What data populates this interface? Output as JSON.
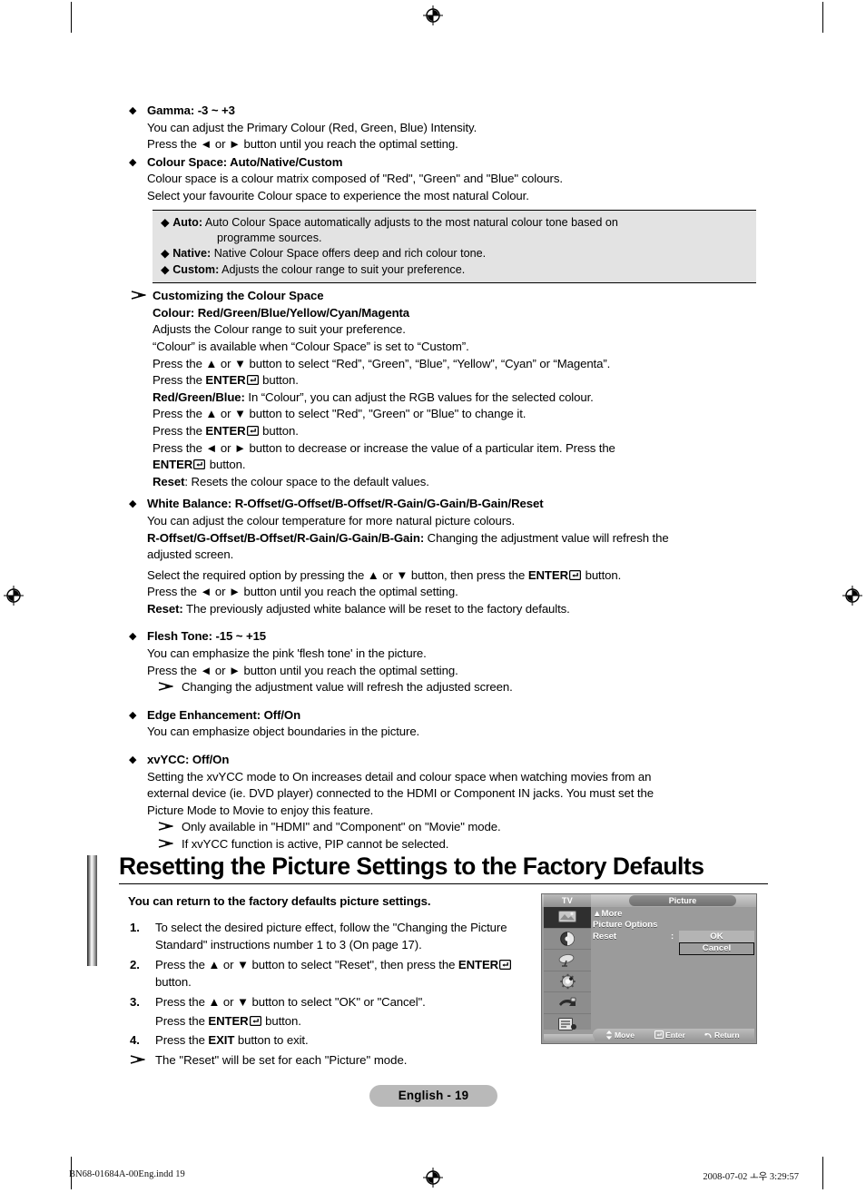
{
  "page": {
    "language_badge": "English - 19",
    "print_footer_left": "BN68-01684A-00Eng.indd   19",
    "print_footer_right": "2008-07-02   ㅗ우 3:29:57"
  },
  "sections": [
    {
      "id": "gamma",
      "heading": "Gamma: -3 ~ +3",
      "lines": [
        "You can adjust the Primary Colour (Red, Green, Blue) Intensity.",
        "Press the ◄ or ► button until you reach the optimal setting."
      ]
    },
    {
      "id": "colour-space",
      "heading": "Colour Space: Auto/Native/Custom",
      "lines": [
        "Colour space is a colour matrix composed of \"Red\", \"Green\" and \"Blue\" colours.",
        "Select your favourite Colour space to experience the most natural Colour."
      ]
    }
  ],
  "option_box": {
    "items": [
      {
        "term": "Auto:",
        "text": "Auto Colour Space automatically adjusts to the most natural colour tone based on",
        "cont": "programme sources."
      },
      {
        "term": "Native:",
        "text": "Native Colour Space offers deep and rich colour tone."
      },
      {
        "term": "Custom:",
        "text": "Adjusts the colour range to suit your preference."
      }
    ]
  },
  "customizing": {
    "note_title": "Customizing the Colour Space",
    "subheading": "Colour: Red/Green/Blue/Yellow/Cyan/Magenta",
    "lines": [
      "Adjusts the Colour range to suit your preference.",
      "“Colour” is available when “Colour Space” is set to “Custom”.",
      "Press the ▲ or ▼ button to select “Red”, “Green”, “Blue”, “Yellow”, “Cyan” or “Magenta”."
    ],
    "enter_line_1_pre": "Press the ",
    "enter_line_1_bold": "ENTER",
    "enter_line_1_post": " button.",
    "rgb_term": "Red/Green/Blue:",
    "rgb_text": " In “Colour”, you can adjust the RGB values for the selected colour.",
    "rgb_line2": "Press the ▲ or ▼ button to select \"Red\", \"Green\" or \"Blue\" to change it.",
    "decrease_line": "Press the ◄ or ► button to decrease or increase the value of a particular item. Press the",
    "reset_term": "Reset",
    "reset_text": ": Resets the colour space to the default values."
  },
  "white_balance": {
    "heading": "White Balance: R-Offset/G-Offset/B-Offset/R-Gain/G-Gain/B-Gain/Reset",
    "line1": "You can adjust the colour temperature for more natural picture colours.",
    "term2": "R-Offset/G-Offset/B-Offset/R-Gain/G-Gain/B-Gain:",
    "text2": " Changing the adjustment value will refresh the",
    "line2b": "adjusted screen.",
    "select_pre": "Select the required option by pressing the ▲ or ▼ button, then press the ",
    "select_bold": "ENTER",
    "select_post": " button.",
    "line4": "Press the ◄ or ► button until you reach the optimal setting.",
    "reset_term": "Reset:",
    "reset_text": " The previously adjusted white balance will be reset to the factory defaults."
  },
  "flesh_tone": {
    "heading": "Flesh Tone: -15 ~ +15",
    "lines": [
      "You can emphasize the pink 'flesh tone' in the picture.",
      "Press the ◄ or ► button until you reach the optimal setting."
    ],
    "note": "Changing the adjustment value will refresh the adjusted screen."
  },
  "edge_enhancement": {
    "heading": "Edge Enhancement: Off/On",
    "lines": [
      "You can emphasize object boundaries in the picture."
    ]
  },
  "xvycc": {
    "heading": "xvYCC: Off/On",
    "lines": [
      "Setting the xvYCC mode to On increases detail and colour space when watching movies from an",
      "external device (ie. DVD player) connected to the HDMI or Component IN jacks. You must set the",
      "Picture Mode to Movie to enjoy this feature."
    ],
    "notes": [
      "Only available in \"HDMI\" and \"Component\" on \"Movie\" mode.",
      "If xvYCC function is active, PIP cannot be selected."
    ]
  },
  "reset_section": {
    "title": "Resetting the Picture Settings to the Factory Defaults",
    "lead": "You can return to the factory defaults picture settings.",
    "steps": [
      {
        "num": "1.",
        "text": "To select the desired picture effect, follow the \"Changing the Picture Standard\" instructions number 1 to 3 (On page 17)."
      },
      {
        "num": "2.",
        "pre": "Press the ▲ or ▼ button to select \"Reset\", then press the ",
        "bold": "ENTER",
        "post": " button."
      },
      {
        "num": "3.",
        "text": "Press the ▲ or ▼ button to select \"OK\" or \"Cancel\".",
        "pre2": "Press the ",
        "bold2": "ENTER",
        "post2": " button."
      },
      {
        "num": "4.",
        "pre": "Press the ",
        "bold": "EXIT",
        "post": " button to exit."
      }
    ],
    "note": "The \"Reset\" will be set for each \"Picture\" mode."
  },
  "osd": {
    "tv_label": "TV",
    "title": "Picture",
    "more_label": "More",
    "picture_options_label": "Picture Options",
    "reset_label": "Reset",
    "colon": ":",
    "ok_label": "OK",
    "cancel_label": "Cancel",
    "footer": [
      {
        "icon": "updown-arrow-icon",
        "label": "Move"
      },
      {
        "icon": "enter-icon",
        "label": "Enter"
      },
      {
        "icon": "return-icon",
        "label": "Return"
      }
    ],
    "sidebar_icons": [
      "picture-icon",
      "sound-icon",
      "channel-icon",
      "setup-icon",
      "input-icon",
      "application-icon"
    ]
  },
  "colors": {
    "option_box_bg": "#e3e3e3",
    "osd_bg": "#9b9b9b",
    "badge_bg": "#b9b9b9"
  }
}
